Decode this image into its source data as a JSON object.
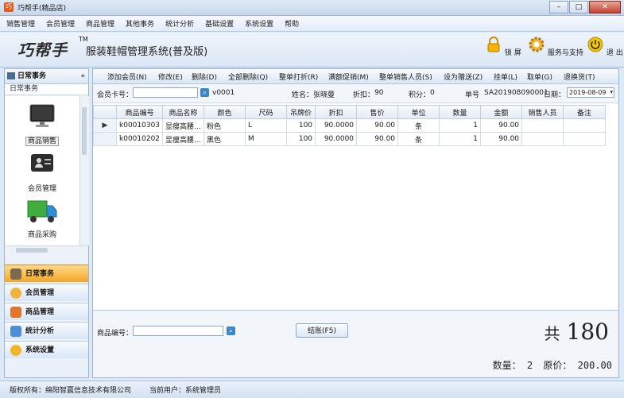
{
  "window": {
    "title": "巧帮手(精品店)"
  },
  "menu": [
    "销售管理",
    "会员管理",
    "商品管理",
    "其他事务",
    "统计分析",
    "基础设置",
    "系统设置",
    "帮助"
  ],
  "header": {
    "logo": "巧帮手",
    "tm": "TM",
    "system_name": "服装鞋帽管理系统(普及版)",
    "lock_label": "锁 屏",
    "service_label": "服务与支持",
    "exit_label": "退 出"
  },
  "left": {
    "title": "日常事务",
    "collapse": "«",
    "subtitle": "日常事务",
    "items": [
      {
        "label": "商品销售"
      },
      {
        "label": "会员管理"
      },
      {
        "label": "商品采购"
      }
    ],
    "nav": [
      "日常事务",
      "会员管理",
      "商品管理",
      "统计分析",
      "系统设置"
    ]
  },
  "toolbar": [
    "添加会员(N)",
    "修改(E)",
    "删除(D)",
    "全部删除(Q)",
    "整单打折(R)",
    "满额促销(M)",
    "整单销售人员(S)",
    "设为赠送(Z)",
    "挂单(L)",
    "取单(G)",
    "退换货(T)"
  ],
  "info": {
    "member_card_label": "会员卡号：",
    "member_card_value": "",
    "member_id": "v0001",
    "name_label": "姓名：",
    "name_value": "张晓曼",
    "discount_label": "折扣：",
    "discount_value": "90",
    "points_label": "积分：",
    "points_value": "0",
    "order_label": "单号",
    "order_value": "SA201908090001",
    "date_label": "日期：",
    "date_value": "2019-08-09"
  },
  "grid": {
    "columns": [
      "商品编号",
      "商品名称",
      "颜色",
      "尺码",
      "吊牌价",
      "折扣",
      "售价",
      "单位",
      "数量",
      "金额",
      "销售人员",
      "备注"
    ],
    "rows": [
      {
        "code": "k00010303",
        "name": "显瘦高腰...",
        "color": "粉色",
        "size": "L",
        "tag_price": "100",
        "discount": "90.0000",
        "price": "90.00",
        "unit": "条",
        "qty": "1",
        "amount": "90.00",
        "seller": "",
        "note": ""
      },
      {
        "code": "k00010202",
        "name": "显瘦高腰...",
        "color": "黑色",
        "size": "M",
        "tag_price": "100",
        "discount": "90.0000",
        "price": "90.00",
        "unit": "条",
        "qty": "1",
        "amount": "90.00",
        "seller": "",
        "note": ""
      }
    ],
    "selected_marker": "▶"
  },
  "bottom": {
    "product_code_label": "商品编号：",
    "product_code_value": "",
    "checkout_label": "结账(F5)",
    "total_label": "共",
    "total_value": "180",
    "qty_label": "数量：",
    "qty_value": "2",
    "orig_label": "原价：",
    "orig_value": "200.00"
  },
  "status": {
    "copyright": "版权所有：绵阳智赢信息技术有限公司",
    "user": "当前用户：系统管理员"
  },
  "colors": {
    "accent": "#f5a623",
    "panel": "#dce9f7",
    "link": "#3f86c9"
  }
}
